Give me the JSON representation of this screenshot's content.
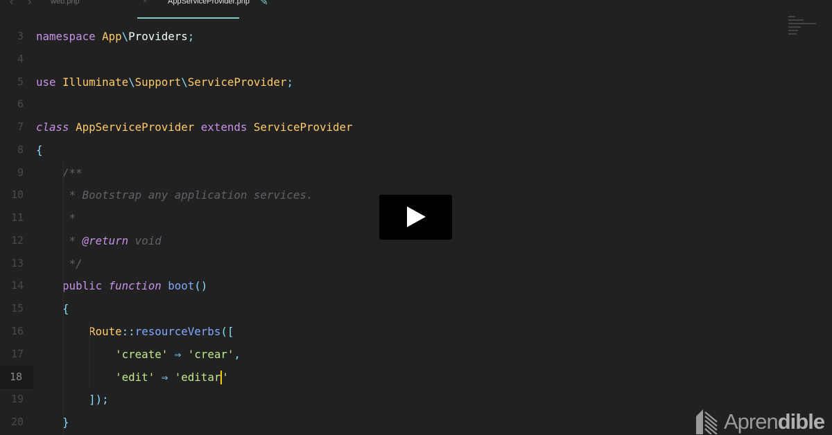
{
  "tabs": {
    "nav_back": "‹",
    "nav_forward": "›",
    "inactive_tab": "web.php",
    "close": "×",
    "active_tab": "AppServiceProvider.php",
    "edit_icon": "✎"
  },
  "lines": [
    {
      "n": "3",
      "tokens": [
        [
          "kw",
          "namespace "
        ],
        [
          "cls",
          "App"
        ],
        [
          "op",
          "\\"
        ],
        [
          "plain",
          "Providers"
        ],
        [
          "op",
          ";"
        ]
      ]
    },
    {
      "n": "4",
      "tokens": []
    },
    {
      "n": "5",
      "tokens": [
        [
          "kw",
          "use "
        ],
        [
          "cls",
          "Illuminate"
        ],
        [
          "op",
          "\\"
        ],
        [
          "cls",
          "Support"
        ],
        [
          "op",
          "\\"
        ],
        [
          "cls",
          "ServiceProvider"
        ],
        [
          "op",
          ";"
        ]
      ]
    },
    {
      "n": "6",
      "tokens": []
    },
    {
      "n": "7",
      "tokens": [
        [
          "kwi",
          "class "
        ],
        [
          "cls",
          "AppServiceProvider "
        ],
        [
          "kw",
          "extends "
        ],
        [
          "cls",
          "ServiceProvider"
        ]
      ]
    },
    {
      "n": "8",
      "tokens": [
        [
          "op",
          "{"
        ]
      ]
    },
    {
      "n": "9",
      "tokens": [
        [
          "plain",
          "    "
        ],
        [
          "cm",
          "/**"
        ]
      ]
    },
    {
      "n": "10",
      "tokens": [
        [
          "plain",
          "     "
        ],
        [
          "cm",
          "* Bootstrap any application services."
        ]
      ]
    },
    {
      "n": "11",
      "tokens": [
        [
          "plain",
          "     "
        ],
        [
          "cm",
          "*"
        ]
      ]
    },
    {
      "n": "12",
      "tokens": [
        [
          "plain",
          "     "
        ],
        [
          "cm",
          "* "
        ],
        [
          "cmkw",
          "@return"
        ],
        [
          "cm",
          " void"
        ]
      ]
    },
    {
      "n": "13",
      "tokens": [
        [
          "plain",
          "     "
        ],
        [
          "cm",
          "*/"
        ]
      ]
    },
    {
      "n": "14",
      "tokens": [
        [
          "plain",
          "    "
        ],
        [
          "kw",
          "public "
        ],
        [
          "kwi",
          "function "
        ],
        [
          "fn",
          "boot"
        ],
        [
          "op",
          "()"
        ]
      ]
    },
    {
      "n": "15",
      "tokens": [
        [
          "plain",
          "    "
        ],
        [
          "op",
          "{"
        ]
      ]
    },
    {
      "n": "16",
      "tokens": [
        [
          "plain",
          "        "
        ],
        [
          "cls",
          "Route"
        ],
        [
          "op",
          "::"
        ],
        [
          "fn",
          "resourceVerbs"
        ],
        [
          "op",
          "(["
        ]
      ]
    },
    {
      "n": "17",
      "tokens": [
        [
          "plain",
          "            "
        ],
        [
          "str",
          "'create'"
        ],
        [
          "op",
          " ⇒ "
        ],
        [
          "str",
          "'crear'"
        ],
        [
          "op",
          ","
        ]
      ]
    },
    {
      "n": "18",
      "current": true,
      "tokens": [
        [
          "plain",
          "            "
        ],
        [
          "str",
          "'edit'"
        ],
        [
          "op",
          " ⇒ "
        ],
        [
          "str",
          "'editar"
        ],
        [
          "cursor",
          ""
        ],
        [
          "str",
          "'"
        ]
      ]
    },
    {
      "n": "19",
      "tokens": [
        [
          "plain",
          "        "
        ],
        [
          "op",
          "]);"
        ]
      ]
    },
    {
      "n": "20",
      "tokens": [
        [
          "plain",
          "    "
        ],
        [
          "op",
          "}"
        ]
      ]
    }
  ],
  "brand": {
    "name_light": "Apren",
    "name_bold": "dible"
  }
}
